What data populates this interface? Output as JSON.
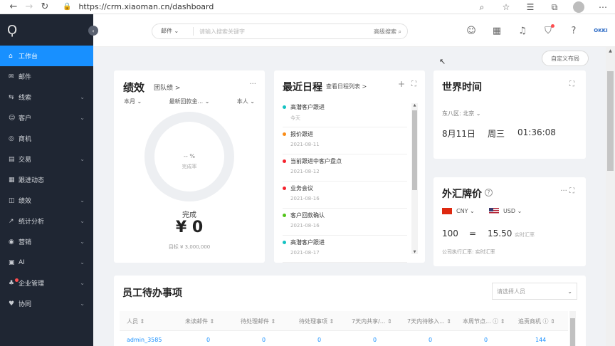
{
  "browser": {
    "url": "https://crm.xiaoman.cn/dashboard",
    "back_icon": "←",
    "forward_icon": "→",
    "reload_icon": "↻",
    "lock_icon": "🔒"
  },
  "sidebar": {
    "logo": "Ϙ",
    "collapse_icon": "‹",
    "items": [
      {
        "label": "工作台",
        "icon": "⌂",
        "chevron": ""
      },
      {
        "label": "邮件",
        "icon": "✉",
        "chevron": ""
      },
      {
        "label": "线索",
        "icon": "⇆",
        "chevron": "⌄"
      },
      {
        "label": "客户",
        "icon": "☺",
        "chevron": "⌄"
      },
      {
        "label": "商机",
        "icon": "◎",
        "chevron": ""
      },
      {
        "label": "交易",
        "icon": "▤",
        "chevron": "⌄"
      },
      {
        "label": "跟进动态",
        "icon": "▦",
        "chevron": ""
      },
      {
        "label": "绩效",
        "icon": "◫",
        "chevron": "⌄"
      },
      {
        "label": "统计分析",
        "icon": "↗",
        "chevron": "⌄"
      },
      {
        "label": "营销",
        "icon": "◉",
        "chevron": "⌄"
      },
      {
        "label": "AI",
        "icon": "▣",
        "chevron": "⌄"
      },
      {
        "label": "企业管理",
        "icon": "♣",
        "chevron": "⌄"
      },
      {
        "label": "协同",
        "icon": "♥",
        "chevron": "⌄"
      }
    ]
  },
  "header": {
    "search_scope": "邮件",
    "search_scope_chevron": "⌄",
    "search_placeholder": "请输入搜索关键字",
    "advanced_search": "高级搜索 ⌕",
    "brand": "OKKI"
  },
  "content": {
    "custom_layout": "自定义布局"
  },
  "performance": {
    "title": "绩效",
    "team_link": "团队绩 >",
    "more": "···",
    "filters": [
      "本月 ⌄",
      "最新回款金... ⌄",
      "本人 ⌄"
    ],
    "percent": "-- %",
    "percent_label": "完成率",
    "done_label": "完成",
    "amount": "¥ 0",
    "target": "目标 ¥ 3,000,000"
  },
  "schedule": {
    "title": "最近日程",
    "sub": "查看日程列表 >",
    "add": "+",
    "expand": "⛶",
    "items": [
      {
        "title": "高潜客户跟进",
        "date": "今天",
        "color": "#13c2c2"
      },
      {
        "title": "报价跟进",
        "date": "2021-08-11",
        "color": "#fa8c16"
      },
      {
        "title": "当前跟进中客户盘点",
        "date": "2021-08-12",
        "color": "#f5222d"
      },
      {
        "title": "业务会议",
        "date": "2021-08-16",
        "color": "#f5222d"
      },
      {
        "title": "客户回款确认",
        "date": "2021-08-16",
        "color": "#52c41a"
      },
      {
        "title": "高潜客户跟进",
        "date": "2021-08-17",
        "color": "#13c2c2"
      }
    ]
  },
  "world_time": {
    "title": "世界时间",
    "expand": "⛶",
    "timezone": "东八区: 北京 ⌄",
    "date": "8月11日",
    "weekday": "周三",
    "time": "01:36:08"
  },
  "fx": {
    "title": "外汇牌价",
    "help": "?",
    "controls": "··· ⛶",
    "from_currency": "CNY ⌄",
    "to_currency": "USD ⌄",
    "amount": "100",
    "equals": "=",
    "result": "15.50",
    "rate_label": "实时汇率",
    "source": "公司执行汇率: 实时汇率"
  },
  "todo": {
    "title": "员工待办事项",
    "filter_placeholder": "请选择人员",
    "filter_chevron": "⌄",
    "columns": [
      "人员 ⇕",
      "未读邮件 ⇕",
      "待处理邮件 ⇕",
      "待处理事项 ⇕",
      "7天内共享/... ⇕",
      "7天内待移入... ⇕",
      "本周节点... ⓘ ⇕",
      "追责商机 ⓘ ⇕"
    ],
    "rows": [
      {
        "name": "admin_3585",
        "values": [
          "0",
          "0",
          "0",
          "0",
          "0",
          "0",
          "144"
        ]
      }
    ]
  }
}
